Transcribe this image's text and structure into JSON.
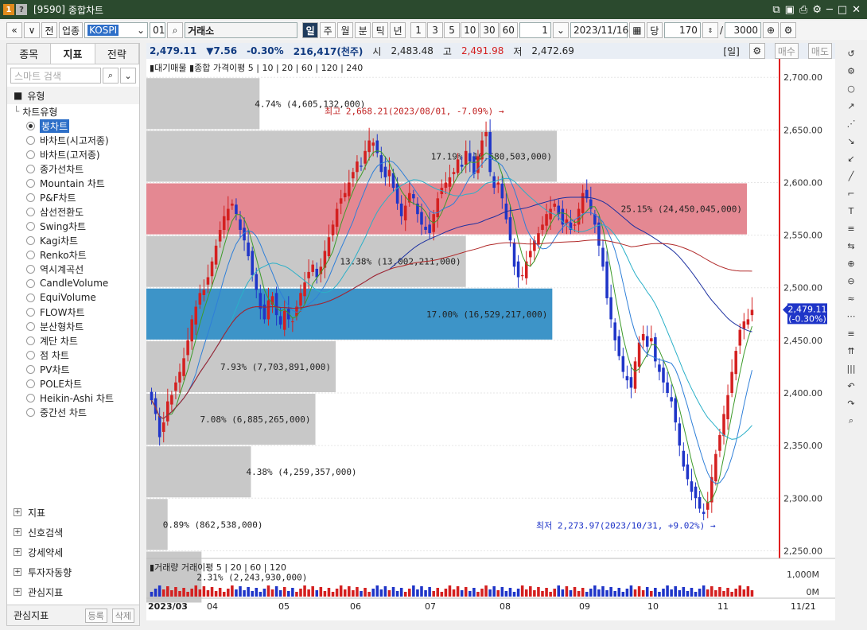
{
  "window": {
    "code": "[9590]",
    "title": "종합차트",
    "badge1": "1",
    "badge2": "?"
  },
  "toolbar": {
    "nav_prev": "«",
    "nav_menu": "∨",
    "prev_label": "전",
    "market_type": "업종",
    "symbol_code": "KOSPI",
    "index_code": "01",
    "index_name": "거래소",
    "periods": [
      "일",
      "주",
      "월",
      "분",
      "틱",
      "년"
    ],
    "active_period": "일",
    "numbers": [
      "1",
      "3",
      "5",
      "10",
      "30",
      "60"
    ],
    "count_select": "1",
    "date": "2023/11/16",
    "unit": "당",
    "view_count": "170",
    "slash": "/",
    "total_count": "3000"
  },
  "left": {
    "tabs": [
      "종목",
      "지표",
      "전략"
    ],
    "active_tab": "지표",
    "search_placeholder": "스마트 검색",
    "section_type": "유형",
    "tree_head": "차트유형",
    "chart_types": [
      "봉차트",
      "바차트(시고저종)",
      "바차트(고저종)",
      "종가선차트",
      "Mountain 차트",
      "P&F차트",
      "삼선전환도",
      "Swing차트",
      "Kagi차트",
      "Renko차트",
      "역시계곡선",
      "CandleVolume",
      "EquiVolume",
      "FLOW차트",
      "분산형차트",
      "계단 차트",
      "점 차트",
      "PV차트",
      "POLE차트",
      "Heikin-Ashi 차트",
      "중간선 차트"
    ],
    "selected_type": "봉차트",
    "bottom_sections": [
      "지표",
      "신호검색",
      "강세약세",
      "투자자동향",
      "관심지표"
    ],
    "fav_label": "관심지표",
    "fav_register": "등록",
    "fav_delete": "삭제"
  },
  "info": {
    "price": "2,479.11",
    "change": "▼7.56",
    "change_pct": "-0.30%",
    "volume": "216,417(천주)",
    "open_label": "시",
    "open": "2,483.48",
    "high_label": "고",
    "high": "2,491.98",
    "low_label": "저",
    "low": "2,472.69",
    "period_tag": "[일]",
    "buy": "매수",
    "sell": "매도"
  },
  "legend_price": {
    "prefix": "▮대기매물",
    "main": "▮종합",
    "ma_label": "가격이평",
    "ma": [
      "5",
      "10",
      "20",
      "60",
      "120",
      "240"
    ]
  },
  "legend_volume": {
    "prefix": "▮거래량",
    "ma_label": "거래이평",
    "ma": [
      "5",
      "20",
      "60",
      "120"
    ]
  },
  "chart_data": {
    "type": "candlestick",
    "x_labels": [
      "2023/03",
      "04",
      "05",
      "06",
      "07",
      "08",
      "09",
      "10",
      "11",
      "11/21"
    ],
    "y_ticks": [
      2700,
      2650,
      2600,
      2550,
      2500,
      2450,
      2400,
      2350,
      2300,
      2250
    ],
    "y_tick_labels": [
      "2,700.00",
      "2,650.00",
      "2,600.00",
      "2,550.00",
      "2,500.00",
      "2,450.00",
      "2,400.00",
      "2,350.00",
      "2,300.00",
      "2,250.00"
    ],
    "ylim": [
      2245,
      2710
    ],
    "current": {
      "value": 2479.11,
      "label": "2,479.11",
      "pct_label": "(-0.30%)"
    },
    "max_annotation": "최고 2,668.21(2023/08/01, -7.09%)",
    "min_annotation": "최저 2,273.97(2023/10/31, +9.02%)",
    "volume_profile": [
      {
        "lo": 2650,
        "hi": 2700,
        "pct": 4.74,
        "label": "4.74% (4,605,132,000)"
      },
      {
        "lo": 2600,
        "hi": 2650,
        "pct": 17.19,
        "label": "17.19% (16,680,503,000)"
      },
      {
        "lo": 2550,
        "hi": 2600,
        "pct": 25.15,
        "label": "25.15% (24,450,045,000)"
      },
      {
        "lo": 2500,
        "hi": 2550,
        "pct": 13.38,
        "label": "13.38% (13,002,211,000)"
      },
      {
        "lo": 2450,
        "hi": 2500,
        "pct": 17.0,
        "label": "17.00% (16,529,217,000)"
      },
      {
        "lo": 2400,
        "hi": 2450,
        "pct": 7.93,
        "label": "7.93% (7,703,891,000)"
      },
      {
        "lo": 2350,
        "hi": 2400,
        "pct": 7.08,
        "label": "7.08% (6,885,265,000)"
      },
      {
        "lo": 2300,
        "hi": 2350,
        "pct": 4.38,
        "label": "4.38% (4,259,357,000)"
      },
      {
        "lo": 2250,
        "hi": 2300,
        "pct": 0.89,
        "label": "0.89% (862,538,000)"
      },
      {
        "lo": 2200,
        "hi": 2250,
        "pct": 2.31,
        "label": "2.31% (2,243,930,000)"
      }
    ],
    "volume_ticks": [
      "1,000M",
      "0M"
    ],
    "colors": {
      "up": "#d42020",
      "down": "#1f35c8",
      "ma5": "#3d9b2a",
      "ma10": "#2f7fd8",
      "ma20": "#2bb0c8",
      "ma60": "#1b2fa0",
      "ma120": "#b02828",
      "profile": "#c8c8c8",
      "profile_top": "#e48892",
      "profile_current": "#3d94c8"
    },
    "closes": [
      2393,
      2380,
      2358,
      2372,
      2392,
      2398,
      2410,
      2420,
      2433,
      2450,
      2470,
      2482,
      2495,
      2498,
      2510,
      2525,
      2540,
      2555,
      2568,
      2575,
      2580,
      2570,
      2555,
      2545,
      2530,
      2512,
      2498,
      2480,
      2470,
      2488,
      2492,
      2474,
      2465,
      2478,
      2470,
      2468,
      2482,
      2495,
      2505,
      2515,
      2522,
      2510,
      2520,
      2535,
      2548,
      2560,
      2575,
      2585,
      2590,
      2600,
      2610,
      2620,
      2615,
      2630,
      2640,
      2638,
      2628,
      2610,
      2605,
      2612,
      2595,
      2580,
      2568,
      2578,
      2590,
      2585,
      2570,
      2560,
      2555,
      2552,
      2570,
      2585,
      2595,
      2600,
      2605,
      2610,
      2622,
      2615,
      2630,
      2620,
      2608,
      2625,
      2640,
      2648,
      2610,
      2595,
      2600,
      2585,
      2565,
      2545,
      2520,
      2510,
      2512,
      2525,
      2535,
      2545,
      2552,
      2560,
      2570,
      2575,
      2580,
      2570,
      2560,
      2565,
      2555,
      2560,
      2575,
      2590,
      2585,
      2575,
      2560,
      2540,
      2520,
      2490,
      2470,
      2450,
      2435,
      2420,
      2412,
      2405,
      2430,
      2448,
      2456,
      2444,
      2452,
      2430,
      2420,
      2410,
      2400,
      2392,
      2372,
      2350,
      2330,
      2318,
      2306,
      2300,
      2290,
      2285,
      2296,
      2320,
      2342,
      2360,
      2380,
      2398,
      2420,
      2440,
      2460,
      2468,
      2470,
      2479
    ]
  }
}
